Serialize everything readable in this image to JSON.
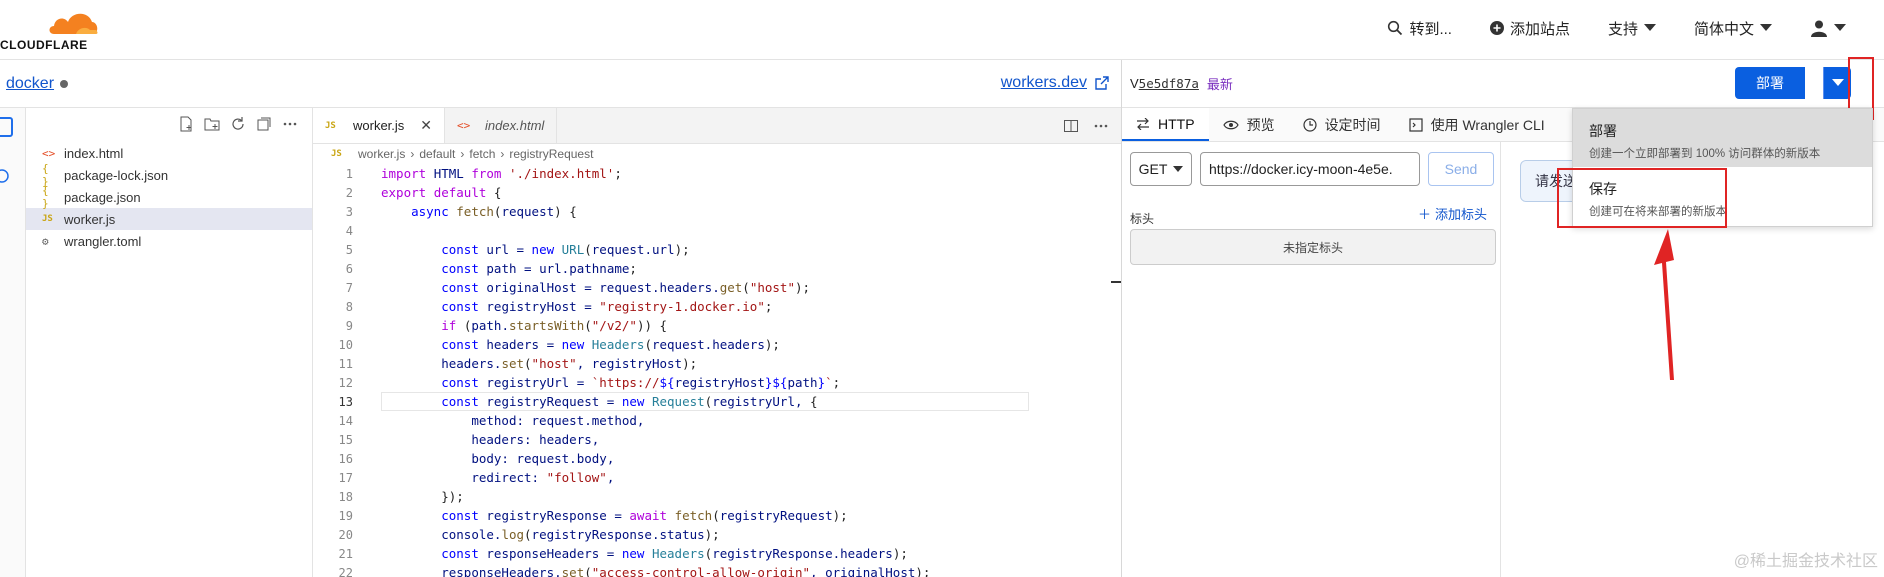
{
  "brand": {
    "logo_text": "CLOUDFLARE",
    "accent": "#f48120"
  },
  "topnav": {
    "goto": "转到...",
    "add_site": "添加站点",
    "support": "支持",
    "language": "简体中文"
  },
  "editor": {
    "project_name": "docker",
    "workers_link": "workers.dev",
    "files": [
      "index.html",
      "package-lock.json",
      "package.json",
      "worker.js",
      "wrangler.toml"
    ],
    "active_file": "worker.js",
    "tabs": [
      "worker.js",
      "index.html"
    ],
    "breadcrumb": [
      "worker.js",
      "default",
      "fetch",
      "registryRequest"
    ],
    "line_numbers": [
      "1",
      "2",
      "3",
      "4",
      "5",
      "6",
      "7",
      "8",
      "9",
      "10",
      "11",
      "12",
      "13",
      "14",
      "15",
      "16",
      "17",
      "18",
      "19",
      "20",
      "21",
      "22"
    ]
  },
  "right": {
    "version_prefix": "V",
    "version_id": "5e5df87a",
    "version_tag": "最新",
    "deploy_label": "部署",
    "tabs": [
      "HTTP",
      "预览",
      "设定时间",
      "使用 Wrangler CLI"
    ],
    "method": "GET",
    "url": "https://docker.icy-moon-4e5e.",
    "send_label": "Send",
    "send_hint": "请发送",
    "headers_label": "标头",
    "add_header": "添加标头",
    "no_headers": "未指定标头"
  },
  "dropdown": {
    "deploy_title": "部署",
    "deploy_desc": "创建一个立即部署到 100% 访问群体的新版本",
    "save_title": "保存",
    "save_desc": "创建可在将来部署的新版本"
  },
  "watermark": "@稀土掘金技术社区"
}
